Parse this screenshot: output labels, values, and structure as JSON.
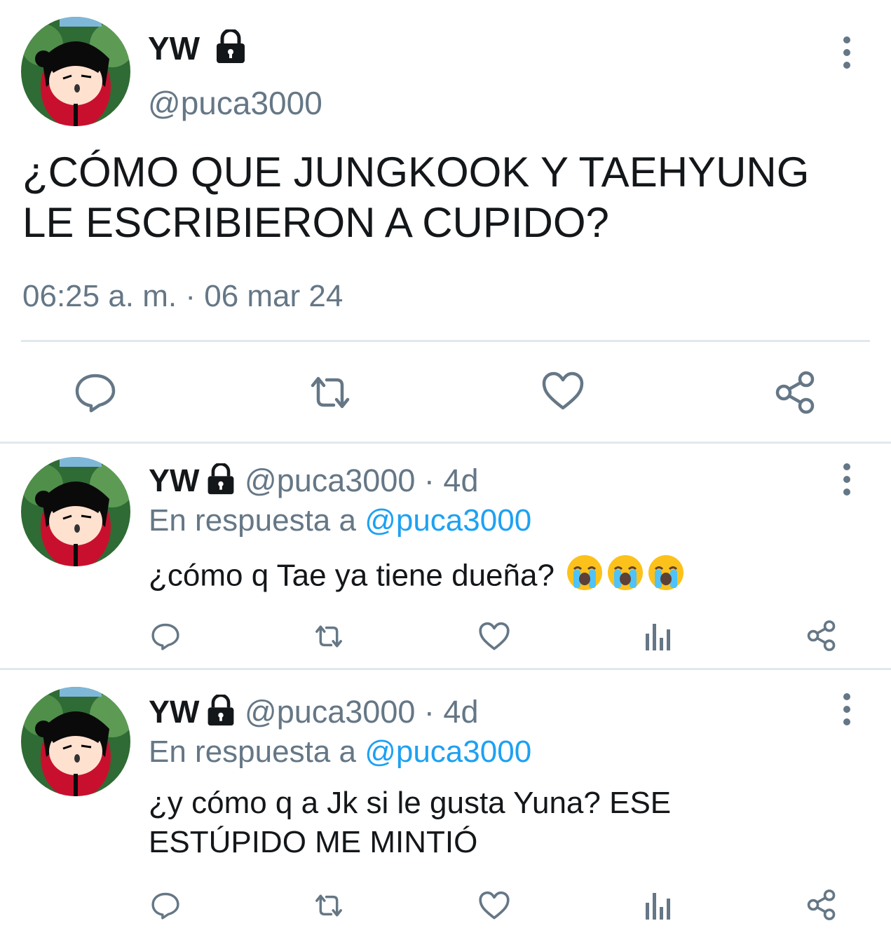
{
  "main_tweet": {
    "name": "YW",
    "handle": "@puca3000",
    "text": "¿CÓMO QUE JUNGKOOK Y TAEHYUNG LE ESCRIBIERON A CUPIDO?",
    "timestamp": "06:25 a. m. · 06 mar 24",
    "actions": [
      "reply-icon",
      "retweet-icon",
      "like-icon",
      "share-icon"
    ]
  },
  "replies": [
    {
      "name": "YW",
      "handle": "@puca3000",
      "separator": "·",
      "age": "4d",
      "replying_prefix": "En respuesta a",
      "replying_to": "@puca3000",
      "text": "¿cómo q Tae ya tiene dueña?",
      "emoji": [
        "loudly-crying-face",
        "loudly-crying-face",
        "loudly-crying-face"
      ],
      "actions": [
        "reply-icon",
        "retweet-icon",
        "like-icon",
        "analytics-icon",
        "share-icon"
      ]
    },
    {
      "name": "YW",
      "handle": "@puca3000",
      "separator": "·",
      "age": "4d",
      "replying_prefix": "En respuesta a",
      "replying_to": "@puca3000",
      "text": "¿y cómo q a Jk si le gusta Yuna? ESE ESTÚPIDO ME MINTIÓ",
      "actions": [
        "reply-icon",
        "retweet-icon",
        "like-icon",
        "analytics-icon",
        "share-icon"
      ]
    }
  ],
  "colors": {
    "text": "#14171a",
    "secondary": "#657786",
    "link": "#1da1f2",
    "divider": "#e1e8ed",
    "icon": "#657786"
  }
}
